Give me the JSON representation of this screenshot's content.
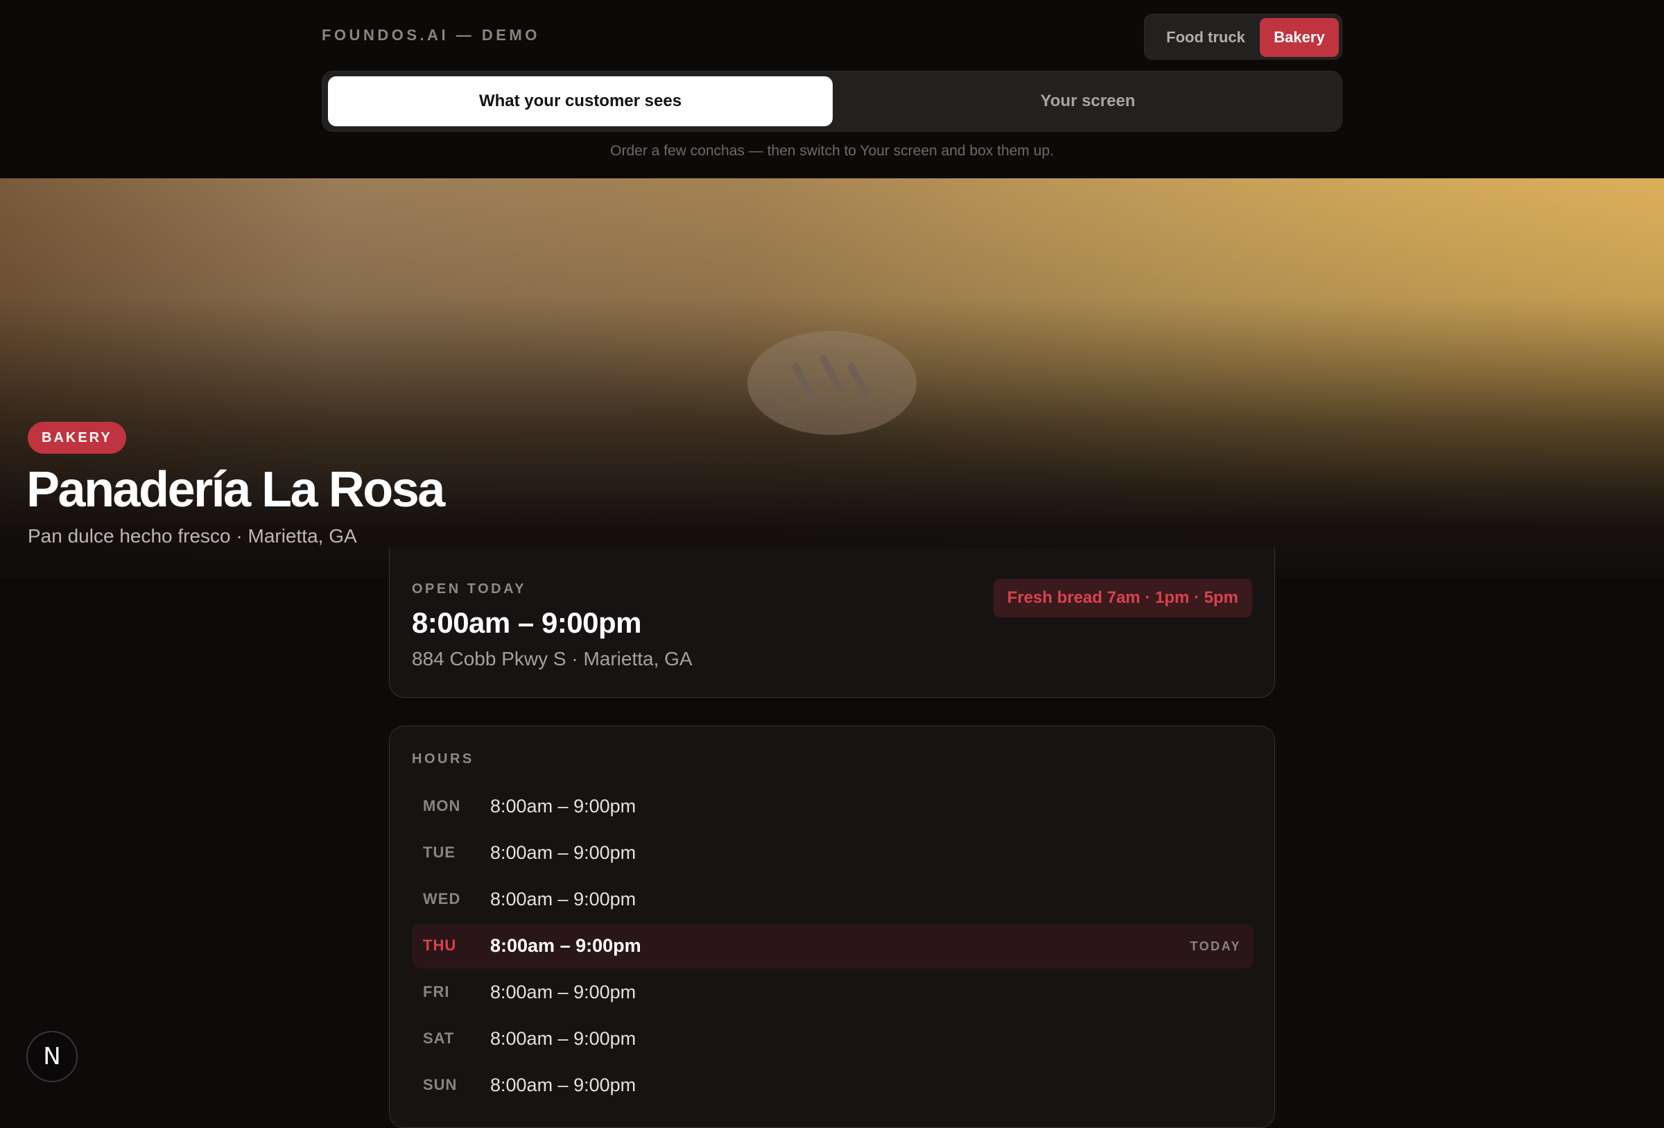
{
  "header": {
    "brand": "FOUNDOS.AI — DEMO",
    "vertical_switch": {
      "food_truck": "Food truck",
      "bakery": "Bakery",
      "selected": "Bakery"
    },
    "view_switch": {
      "customer": "What your customer sees",
      "screen": "Your screen",
      "selected": "What your customer sees"
    },
    "hint": "Order a few conchas — then switch to Your screen and box them up."
  },
  "hero": {
    "badge": "BAKERY",
    "title": "Panadería La Rosa",
    "subtitle": "Pan dulce hecho fresco · Marietta, GA",
    "image_icon": "concha-bread-icon"
  },
  "open_card": {
    "label": "OPEN TODAY",
    "time": "8:00am – 9:00pm",
    "address": "884 Cobb Pkwy S · Marietta, GA",
    "fresh_bread": "Fresh bread 7am · 1pm · 5pm"
  },
  "hours_card": {
    "label": "HOURS",
    "today_tag": "TODAY",
    "rows": [
      {
        "day": "MON",
        "time": "8:00am – 9:00pm"
      },
      {
        "day": "TUE",
        "time": "8:00am – 9:00pm"
      },
      {
        "day": "WED",
        "time": "8:00am – 9:00pm"
      },
      {
        "day": "THU",
        "time": "8:00am – 9:00pm"
      },
      {
        "day": "FRI",
        "time": "8:00am – 9:00pm"
      },
      {
        "day": "SAT",
        "time": "8:00am – 9:00pm"
      },
      {
        "day": "SUN",
        "time": "8:00am – 9:00pm"
      }
    ]
  },
  "floating_button": {
    "label": "N",
    "icon": "nextjs-icon"
  },
  "colors": {
    "accent": "#c0343f",
    "background": "#0d0a0a",
    "card": "#181313",
    "hero_gold": "#d8ad5a"
  }
}
